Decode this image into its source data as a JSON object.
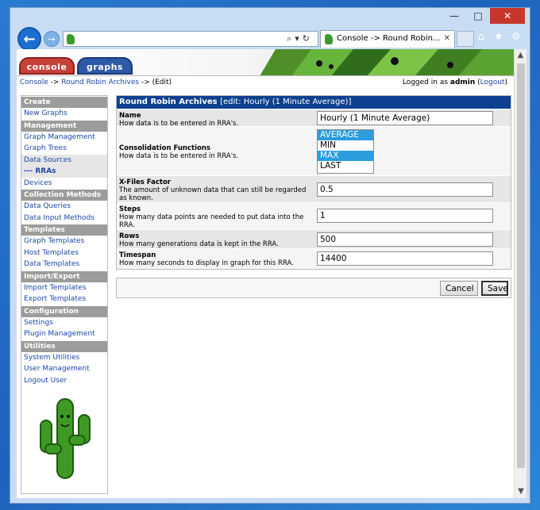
{
  "browser": {
    "tab_title": "Console -> Round Robin...",
    "address": ""
  },
  "cacti": {
    "tabs": {
      "console": "console",
      "graphs": "graphs"
    },
    "breadcrumb": {
      "console": "Console",
      "sep1": " -> ",
      "rra": "Round Robin Archives",
      "sep2": " -> ",
      "edit": "(Edit)"
    },
    "login": {
      "prefix": "Logged in as ",
      "user": "admin",
      "open": " (",
      "logout": "Logout",
      "close": ")"
    }
  },
  "sidebar": {
    "create": "Create",
    "new_graphs": "New Graphs",
    "management": "Management",
    "graph_management": "Graph Management",
    "graph_trees": "Graph Trees",
    "data_sources": "Data Sources",
    "rras": "--- RRAs",
    "devices": "Devices",
    "collection_methods": "Collection Methods",
    "data_queries": "Data Queries",
    "data_input_methods": "Data Input Methods",
    "templates": "Templates",
    "graph_templates": "Graph Templates",
    "host_templates": "Host Templates",
    "data_templates": "Data Templates",
    "import_export": "Import/Export",
    "import_templates": "Import Templates",
    "export_templates": "Export Templates",
    "configuration": "Configuration",
    "settings": "Settings",
    "plugin_management": "Plugin Management",
    "utilities": "Utilities",
    "system_utilities": "System Utilities",
    "user_management": "User Management",
    "logout_user": "Logout User"
  },
  "form": {
    "title": "Round Robin Archives",
    "subtitle": "[edit: Hourly (1 Minute Average)]",
    "name": {
      "label": "Name",
      "desc": "How data is to be entered in RRA's.",
      "value": "Hourly (1 Minute Average)"
    },
    "cf": {
      "label": "Consolidation Functions",
      "desc": "How data is to be entered in RRA's.",
      "options": [
        "AVERAGE",
        "MIN",
        "MAX",
        "LAST"
      ]
    },
    "xff": {
      "label": "X-Files Factor",
      "desc": "The amount of unknown data that can still be regarded as known.",
      "value": "0.5"
    },
    "steps": {
      "label": "Steps",
      "desc": "How many data points are needed to put data into the RRA.",
      "value": "1"
    },
    "rows": {
      "label": "Rows",
      "desc": "How many generations data is kept in the RRA.",
      "value": "500"
    },
    "timespan": {
      "label": "Timespan",
      "desc": "How many seconds to display in graph for this RRA.",
      "value": "14400"
    }
  },
  "actions": {
    "cancel": "Cancel",
    "save": "Save"
  },
  "colors": {
    "header_blue": "#0d4090",
    "link": "#1d47a6",
    "section_gray": "#9c9c9c",
    "selected": "#2b9cde"
  }
}
